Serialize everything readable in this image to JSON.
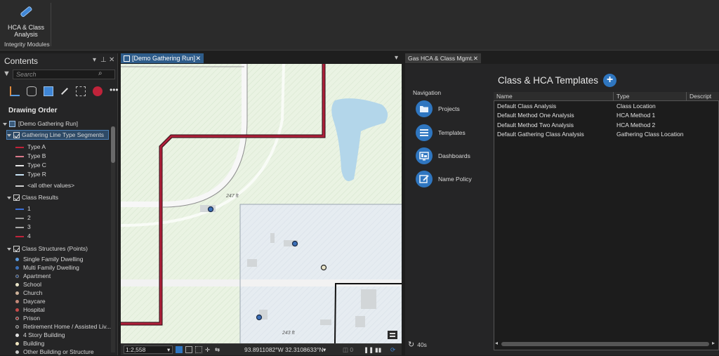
{
  "ribbon": {
    "button_label": "HCA & Class Analysis",
    "group_label": "Integrity Modules"
  },
  "contents": {
    "title": "Contents",
    "search_placeholder": "Search",
    "drawing_order": "Drawing Order",
    "map_name": "[Demo Gathering Run]",
    "layers": [
      {
        "label": "Gathering Line Type Segments",
        "items": [
          {
            "label": "Type A",
            "color": "#c0233a"
          },
          {
            "label": "Type B",
            "color": "#d9798a"
          },
          {
            "label": "Type C",
            "color": "#e6e6e6"
          },
          {
            "label": "Type R",
            "color": "#c9e3f5"
          },
          {
            "label": "<all other values>",
            "color": "#cfcfcf"
          }
        ]
      },
      {
        "label": "Class Results",
        "items": [
          {
            "label": "1",
            "color": "#3a6fd8"
          },
          {
            "label": "2",
            "color": "#9a9a9a"
          },
          {
            "label": "3",
            "color": "#a8a8a8"
          },
          {
            "label": "4",
            "color": "#c0233a"
          }
        ]
      },
      {
        "label": "Class Structures (Points)",
        "items": [
          {
            "label": "Single Family Dwelling",
            "color": "#5a9be0"
          },
          {
            "label": "Multi Family Dwelling",
            "color": "#3b6fb8"
          },
          {
            "label": "Apartment",
            "color": "#1d3b6e"
          },
          {
            "label": "School",
            "color": "#e8e4c8"
          },
          {
            "label": "Church",
            "color": "#cdb29a"
          },
          {
            "label": "Daycare",
            "color": "#c58a7a"
          },
          {
            "label": "Hospital",
            "color": "#c74a4a"
          },
          {
            "label": "Prison",
            "color": "#8a1e1e"
          },
          {
            "label": "Retirement Home / Assisted Liv...",
            "color": "#444444"
          },
          {
            "label": "4 Story Building",
            "color": "#e0e0e0"
          },
          {
            "label": "Building",
            "color": "#f0e6c0"
          },
          {
            "label": "Other Building or Structure",
            "color": "#c8c8c8"
          }
        ]
      }
    ]
  },
  "map": {
    "tab_label": "[Demo Gathering Run]",
    "scale": "1:2,558",
    "coordinates": "93.8911082°W 32.3108633°N",
    "annotation_1": "247 ft",
    "annotation_2": "243 ft"
  },
  "hca_pane": {
    "tab_label": "Gas HCA & Class Mgmt.",
    "nav_title": "Navigation",
    "nav_items": [
      {
        "label": "Projects",
        "icon": "folder-icon"
      },
      {
        "label": "Templates",
        "icon": "list-icon"
      },
      {
        "label": "Dashboards",
        "icon": "dashboard-icon"
      },
      {
        "label": "Name Policy",
        "icon": "edit-icon"
      }
    ],
    "refresh_label": "40s",
    "templates_title": "Class & HCA Templates",
    "columns": [
      "Name",
      "Type",
      "Descript"
    ],
    "rows": [
      {
        "name": "Default Class Analysis",
        "type": "Class Location"
      },
      {
        "name": "Default Method One Analysis",
        "type": "HCA Method 1"
      },
      {
        "name": "Default Method Two Analysis",
        "type": "HCA Method 2"
      },
      {
        "name": "Default Gathering Class Analysis",
        "type": "Gathering Class Location"
      }
    ]
  },
  "colors": {
    "accent": "#2f76c0",
    "pipeline": "#b0203a"
  }
}
